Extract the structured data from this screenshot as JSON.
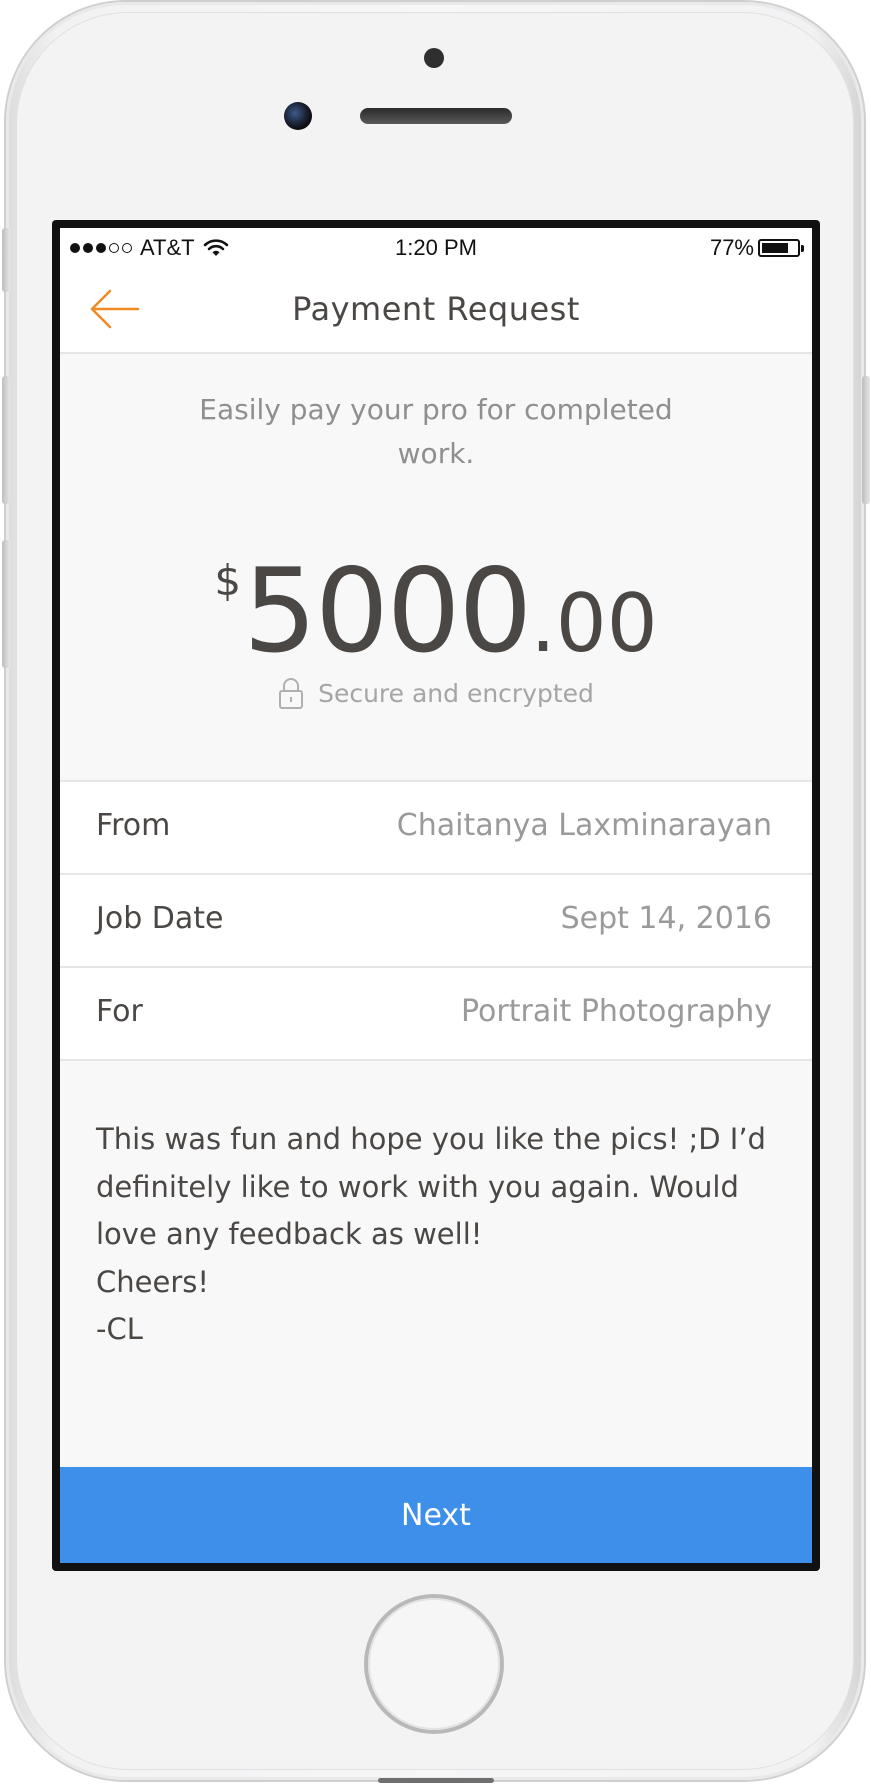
{
  "status_bar": {
    "carrier": "AT&T",
    "time": "1:20 PM",
    "battery_percent": "77%",
    "battery_level": 0.77,
    "signal_bars_filled": 3,
    "signal_bars_total": 5
  },
  "nav": {
    "title": "Payment Request",
    "back_icon": "arrow-left-icon"
  },
  "intro": {
    "subtitle": "Easily pay your pro for completed work."
  },
  "amount": {
    "currency_symbol": "$",
    "whole": "5000",
    "cents": ".00"
  },
  "security": {
    "label": "Secure and encrypted",
    "icon": "lock-icon"
  },
  "details": [
    {
      "label": "From",
      "value": "Chaitanya Laxminarayan"
    },
    {
      "label": "Job Date",
      "value": "Sept 14, 2016"
    },
    {
      "label": "For",
      "value": "Portrait Photography"
    }
  ],
  "message": {
    "lines": [
      "This was fun and hope you like the pics! ;D I’d",
      "definitely like to work with you again. Would",
      "love any feedback as well!",
      "Cheers!",
      "-CL"
    ]
  },
  "footer": {
    "next_label": "Next"
  },
  "colors": {
    "accent_orange": "#f08a24",
    "primary_blue": "#3d8fea",
    "text_dark": "#4a4745",
    "text_muted": "#9a9a9a"
  }
}
